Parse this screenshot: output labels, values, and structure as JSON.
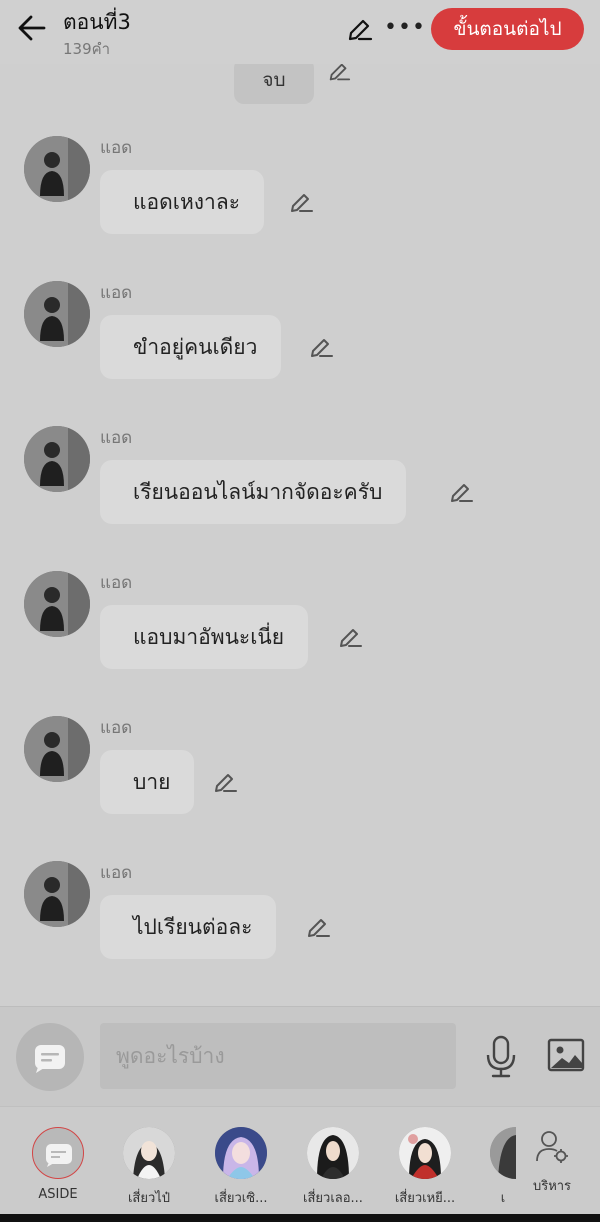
{
  "header": {
    "title": "ตอนที่3",
    "subtitle": "139คำ",
    "next_label": "ขั้นตอนต่อไป"
  },
  "chat": {
    "end_label": "จบ",
    "messages": [
      {
        "sender": "แอด",
        "text": "แอดเหงาละ"
      },
      {
        "sender": "แอด",
        "text": "ขำอยู่คนเดียว"
      },
      {
        "sender": "แอด",
        "text": "เรียนออนไลน์มากจัดอะครับ"
      },
      {
        "sender": "แอด",
        "text": "แอบมาอัพนะเนี่ย"
      },
      {
        "sender": "แอด",
        "text": "บาย"
      },
      {
        "sender": "แอด",
        "text": "ไปเรียนต่อละ"
      }
    ]
  },
  "composer": {
    "placeholder": "พูดอะไรบ้าง"
  },
  "characters": [
    {
      "label": "ASIDE"
    },
    {
      "label": "เสี่ยวไป๋"
    },
    {
      "label": "เสี่ยวเซิ..."
    },
    {
      "label": "เสี่ยวเลอ..."
    },
    {
      "label": "เสี่ยวเหยี..."
    },
    {
      "label": "เ"
    }
  ],
  "manage_label": "บริหาร",
  "colors": {
    "accent": "#d73c3d",
    "background": "#cfcfcf",
    "bubble": "#dadada"
  }
}
